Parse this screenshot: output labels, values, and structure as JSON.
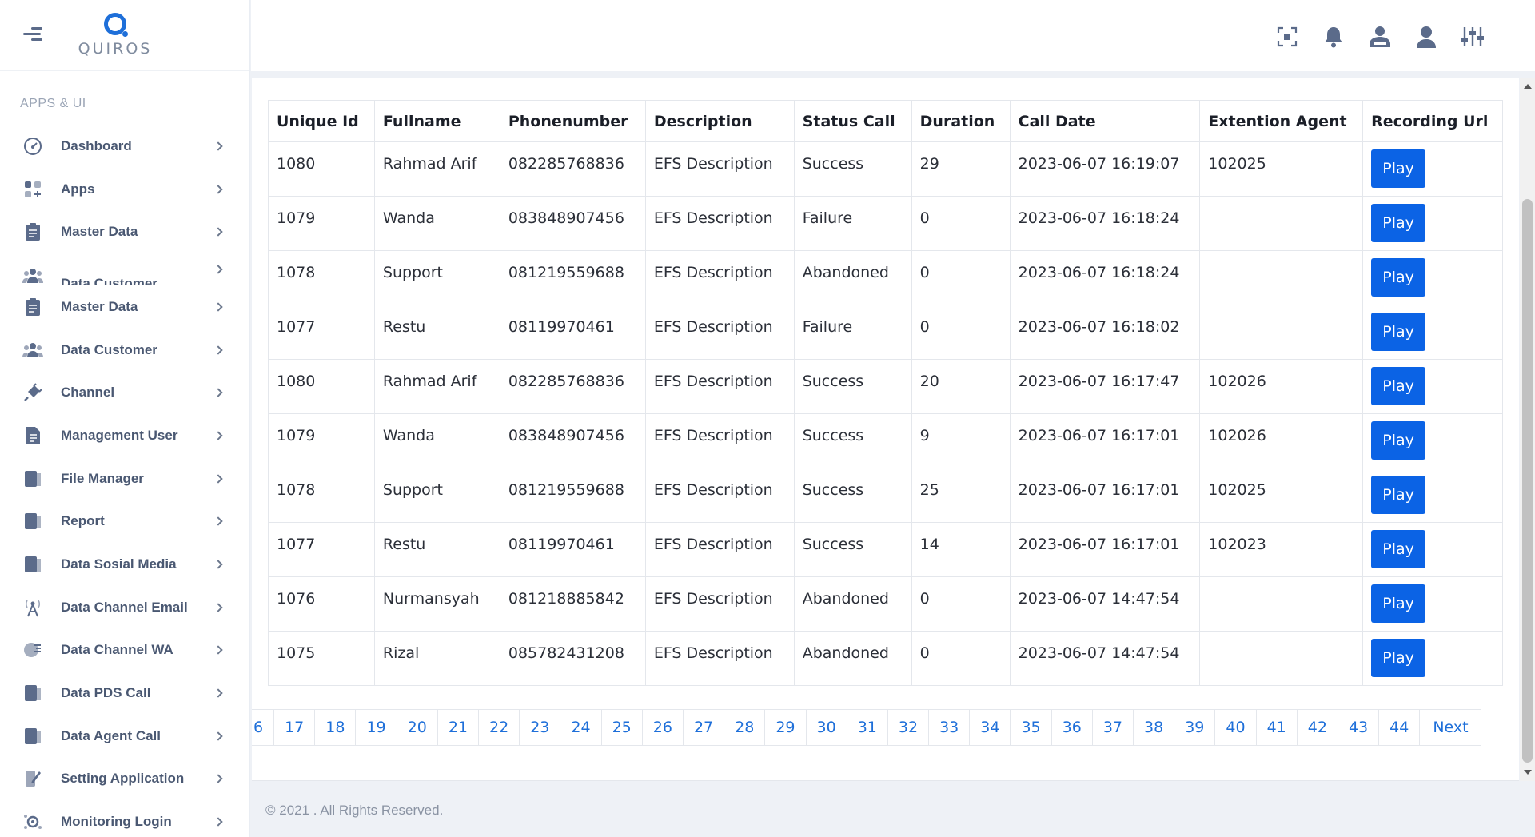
{
  "app": {
    "logo_text": "QUIROS"
  },
  "sidebar": {
    "section_label": "APPS & UI",
    "items": [
      {
        "label": "Dashboard",
        "icon": "gauge-icon"
      },
      {
        "label": "Apps",
        "icon": "apps-grid-icon"
      },
      {
        "label": "Master Data",
        "icon": "clipboard-icon"
      },
      {
        "label": "Data Customer",
        "icon": "users-icon"
      },
      {
        "label": "Master Data",
        "icon": "clipboard-icon"
      },
      {
        "label": "Data Customer",
        "icon": "users-icon"
      },
      {
        "label": "Channel",
        "icon": "plug-icon"
      },
      {
        "label": "Management User",
        "icon": "document-icon"
      },
      {
        "label": "File Manager",
        "icon": "folder-icon"
      },
      {
        "label": "Report",
        "icon": "report-icon"
      },
      {
        "label": "Data Sosial Media",
        "icon": "social-icon"
      },
      {
        "label": "Data Channel Email",
        "icon": "email-tower-icon"
      },
      {
        "label": "Data Channel WA",
        "icon": "wa-icon"
      },
      {
        "label": "Data PDS Call",
        "icon": "call-icon"
      },
      {
        "label": "Data Agent Call",
        "icon": "agent-icon"
      },
      {
        "label": "Setting Application",
        "icon": "settings-pen-icon"
      },
      {
        "label": "Monitoring Login",
        "icon": "monitor-icon"
      }
    ]
  },
  "header": {
    "icons": [
      "fullscreen-icon",
      "bell-icon",
      "agent-headset-icon",
      "user-icon",
      "sliders-icon"
    ]
  },
  "table": {
    "columns": [
      "Unique Id",
      "Fullname",
      "Phonenumber",
      "Description",
      "Status Call",
      "Duration",
      "Call Date",
      "Extention Agent",
      "Recording Url"
    ],
    "play_label": "Play",
    "rows": [
      {
        "id": "1080",
        "name": "Rahmad Arif",
        "phone": "082285768836",
        "desc": "EFS Description",
        "status": "Success",
        "duration": "29",
        "date": "2023-06-07 16:19:07",
        "ext": "102025"
      },
      {
        "id": "1079",
        "name": "Wanda",
        "phone": "083848907456",
        "desc": "EFS Description",
        "status": "Failure",
        "duration": "0",
        "date": "2023-06-07 16:18:24",
        "ext": ""
      },
      {
        "id": "1078",
        "name": "Support",
        "phone": "081219559688",
        "desc": "EFS Description",
        "status": "Abandoned",
        "duration": "0",
        "date": "2023-06-07 16:18:24",
        "ext": ""
      },
      {
        "id": "1077",
        "name": "Restu",
        "phone": "08119970461",
        "desc": "EFS Description",
        "status": "Failure",
        "duration": "0",
        "date": "2023-06-07 16:18:02",
        "ext": ""
      },
      {
        "id": "1080",
        "name": "Rahmad Arif",
        "phone": "082285768836",
        "desc": "EFS Description",
        "status": "Success",
        "duration": "20",
        "date": "2023-06-07 16:17:47",
        "ext": "102026"
      },
      {
        "id": "1079",
        "name": "Wanda",
        "phone": "083848907456",
        "desc": "EFS Description",
        "status": "Success",
        "duration": "9",
        "date": "2023-06-07 16:17:01",
        "ext": "102026"
      },
      {
        "id": "1078",
        "name": "Support",
        "phone": "081219559688",
        "desc": "EFS Description",
        "status": "Success",
        "duration": "25",
        "date": "2023-06-07 16:17:01",
        "ext": "102025"
      },
      {
        "id": "1077",
        "name": "Restu",
        "phone": "08119970461",
        "desc": "EFS Description",
        "status": "Success",
        "duration": "14",
        "date": "2023-06-07 16:17:01",
        "ext": "102023"
      },
      {
        "id": "1076",
        "name": "Nurmansyah",
        "phone": "081218885842",
        "desc": "EFS Description",
        "status": "Abandoned",
        "duration": "0",
        "date": "2023-06-07 14:47:54",
        "ext": ""
      },
      {
        "id": "1075",
        "name": "Rizal",
        "phone": "085782431208",
        "desc": "EFS Description",
        "status": "Abandoned",
        "duration": "0",
        "date": "2023-06-07 14:47:54",
        "ext": ""
      }
    ]
  },
  "pagination": {
    "pages": [
      "6",
      "17",
      "18",
      "19",
      "20",
      "21",
      "22",
      "23",
      "24",
      "25",
      "26",
      "27",
      "28",
      "29",
      "30",
      "31",
      "32",
      "33",
      "34",
      "35",
      "36",
      "37",
      "38",
      "39",
      "40",
      "41",
      "42",
      "43",
      "44"
    ],
    "next_label": "Next"
  },
  "footer": {
    "text": "© 2021 . All Rights Reserved."
  },
  "colors": {
    "accent": "#0b63e5",
    "link": "#1e6fd9",
    "sidebar_text": "#4a5872",
    "background": "#eef1f6"
  }
}
